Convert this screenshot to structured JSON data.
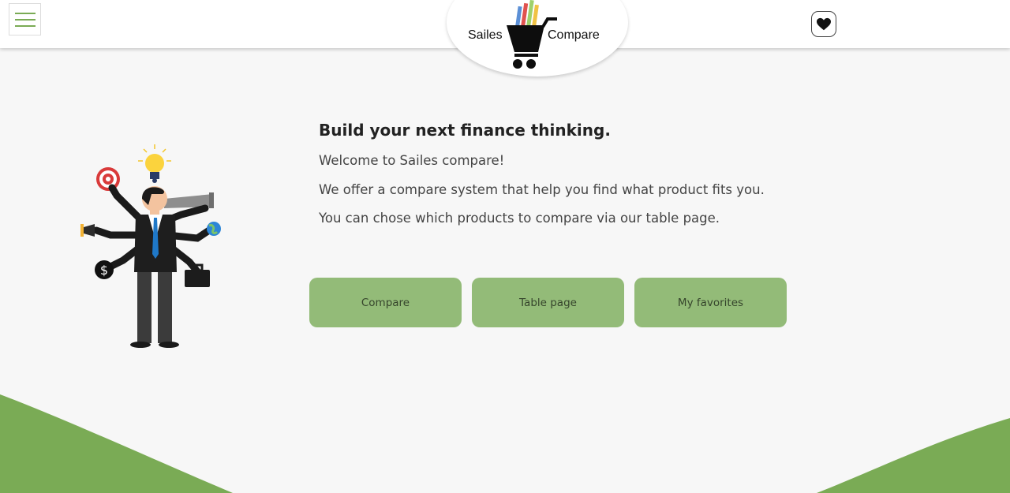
{
  "header": {
    "menu_icon": "hamburger-menu-icon",
    "logo": {
      "left_text": "Sailes",
      "right_text": "Compare",
      "icon": "shopping-cart-icon"
    },
    "favorites_icon": "heart-icon"
  },
  "hero": {
    "illustration": "multitasking-businessman-illustration",
    "heading": "Build your next finance thinking.",
    "paragraphs": [
      "Welcome to Sailes compare!",
      "We offer a compare system that help you find what product fits you.",
      "You can chose which products to compare via our table page."
    ],
    "buttons": [
      {
        "label": "Compare"
      },
      {
        "label": "Table page"
      },
      {
        "label": "My favorites"
      }
    ]
  },
  "colors": {
    "accent_green": "#7aab55",
    "button_green": "#93bb78",
    "background": "#f7f7f7"
  }
}
